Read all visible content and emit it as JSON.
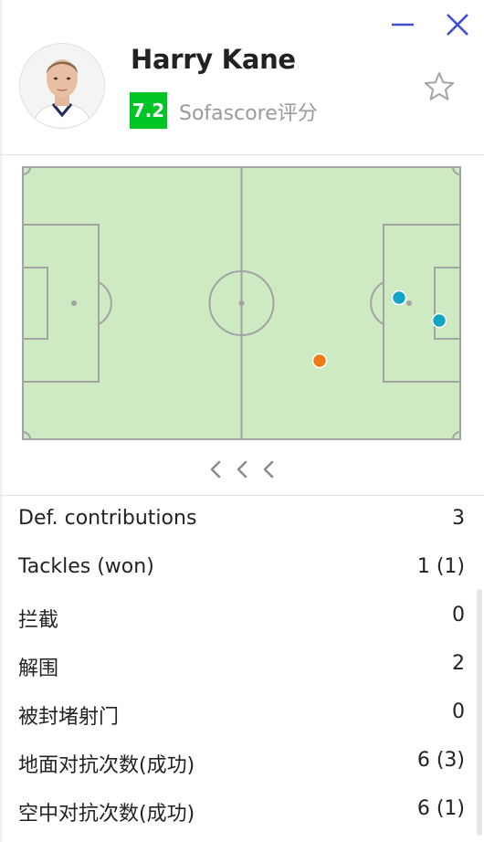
{
  "player": {
    "name": "Harry Kane",
    "rating": "7.2",
    "rating_source": "Sofascore评分",
    "rating_color": "#00c424"
  },
  "window": {
    "minimize_icon": "minus-icon",
    "close_icon": "x-icon",
    "favorite_icon": "star-icon",
    "accent": "#3f4fd0"
  },
  "heatmap": {
    "pitch_color": "#cdeac2",
    "line_color": "#a3a3a3",
    "actions": [
      {
        "type": "defensive",
        "color": "#13a6c4"
      },
      {
        "type": "defensive",
        "color": "#13a6c4"
      },
      {
        "type": "other",
        "color": "#ee7a16"
      }
    ]
  },
  "pager": {
    "icons": [
      "chevron-left-icon",
      "chevron-left-icon",
      "chevron-left-icon"
    ]
  },
  "stats": [
    {
      "label": "Def. contributions",
      "value": "3"
    },
    {
      "label": "Tackles (won)",
      "value": "1 (1)"
    },
    {
      "label": "拦截",
      "value": "0"
    },
    {
      "label": "解围",
      "value": "2"
    },
    {
      "label": "被封堵射门",
      "value": "0"
    },
    {
      "label": "地面对抗次数(成功)",
      "value": "6 (3)"
    },
    {
      "label": "空中对抗次数(成功)",
      "value": "6 (1)"
    }
  ]
}
